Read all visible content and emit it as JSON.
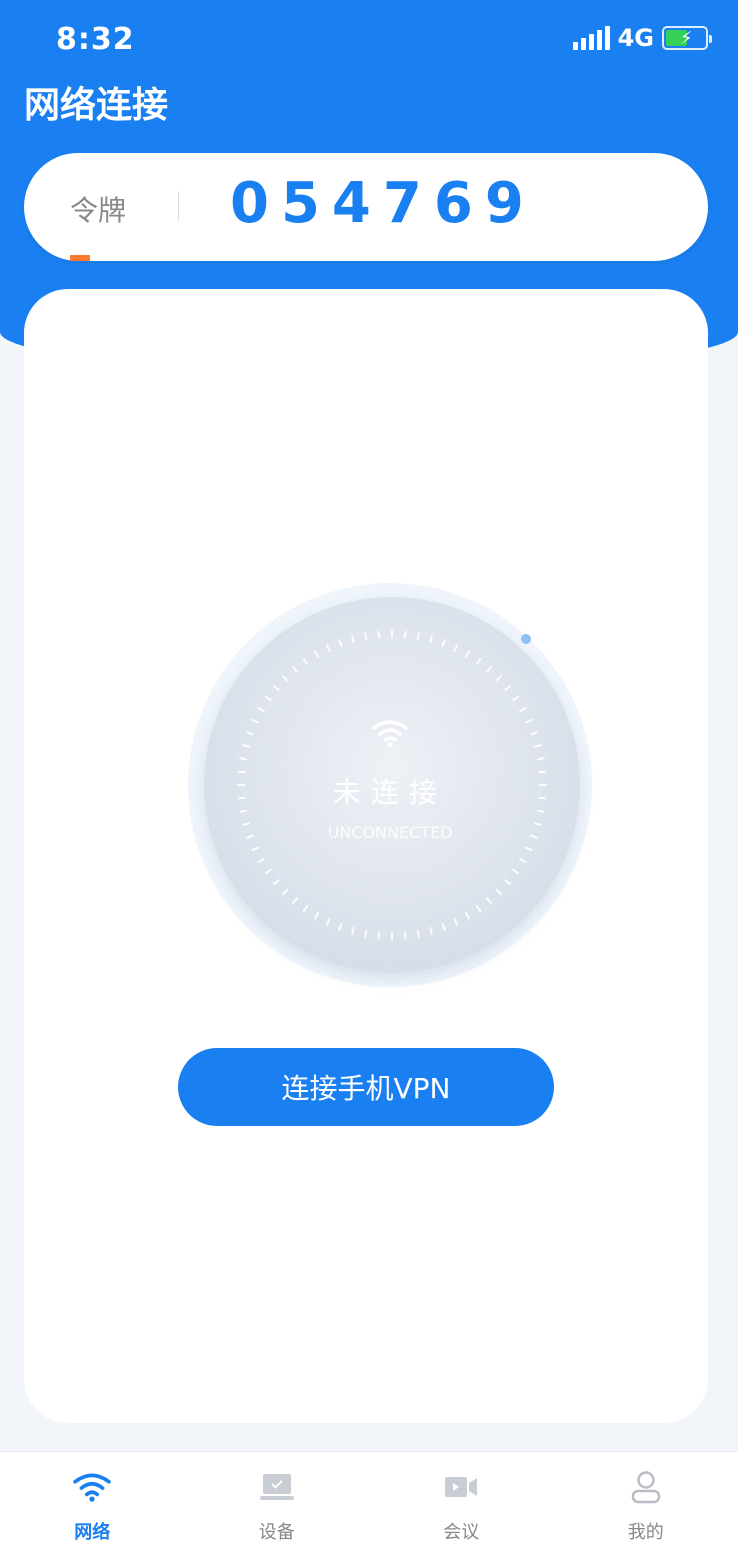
{
  "status_bar": {
    "time": "8:32",
    "network": "4G"
  },
  "header": {
    "title": "网络连接"
  },
  "token": {
    "label": "令牌",
    "value": "054769"
  },
  "connection": {
    "status": "未连接",
    "status_en": "UNCONNECTED",
    "connect_button": "连接手机VPN"
  },
  "tabs": [
    {
      "label": "网络",
      "icon": "wifi-icon",
      "active": true
    },
    {
      "label": "设备",
      "icon": "laptop-icon",
      "active": false
    },
    {
      "label": "会议",
      "icon": "video-icon",
      "active": false
    },
    {
      "label": "我的",
      "icon": "user-icon",
      "active": false
    }
  ],
  "colors": {
    "primary": "#1a7ff0",
    "token_progress": "#ff7a2e",
    "battery": "#34d058",
    "inactive_tab": "#888888"
  }
}
